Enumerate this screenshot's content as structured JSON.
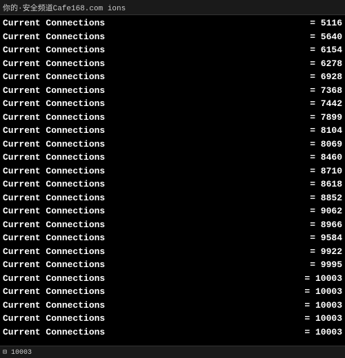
{
  "header": {
    "text": "你的·安全频道Cafe168.com  ions"
  },
  "rows": [
    {
      "label": "Current Connections",
      "value": "= 5116"
    },
    {
      "label": "Current Connections",
      "value": "= 5640"
    },
    {
      "label": "Current Connections",
      "value": "= 6154"
    },
    {
      "label": "Current Connections",
      "value": "= 6278"
    },
    {
      "label": "Current Connections",
      "value": "= 6928"
    },
    {
      "label": "Current Connections",
      "value": "= 7368"
    },
    {
      "label": "Current Connections",
      "value": "= 7442"
    },
    {
      "label": "Current Connections",
      "value": "= 7899"
    },
    {
      "label": "Current Connections",
      "value": "= 8104"
    },
    {
      "label": "Current Connections",
      "value": "= 8069"
    },
    {
      "label": "Current Connections",
      "value": "= 8460"
    },
    {
      "label": "Current Connections",
      "value": "= 8710"
    },
    {
      "label": "Current Connections",
      "value": "= 8618"
    },
    {
      "label": "Current Connections",
      "value": "= 8852"
    },
    {
      "label": "Current Connections",
      "value": "= 9062"
    },
    {
      "label": "Current Connections",
      "value": "= 8966"
    },
    {
      "label": "Current Connections",
      "value": "= 9584"
    },
    {
      "label": "Current Connections",
      "value": "= 9922"
    },
    {
      "label": "Current Connections",
      "value": "= 9995"
    },
    {
      "label": "Current Connections",
      "value": "= 10003"
    },
    {
      "label": "Current Connections",
      "value": "= 10003"
    },
    {
      "label": "Current Connections",
      "value": "= 10003"
    },
    {
      "label": "Current Connections",
      "value": "= 10003"
    },
    {
      "label": "Current Connections",
      "value": "= 10003"
    }
  ],
  "bottom": {
    "text": "10003"
  }
}
